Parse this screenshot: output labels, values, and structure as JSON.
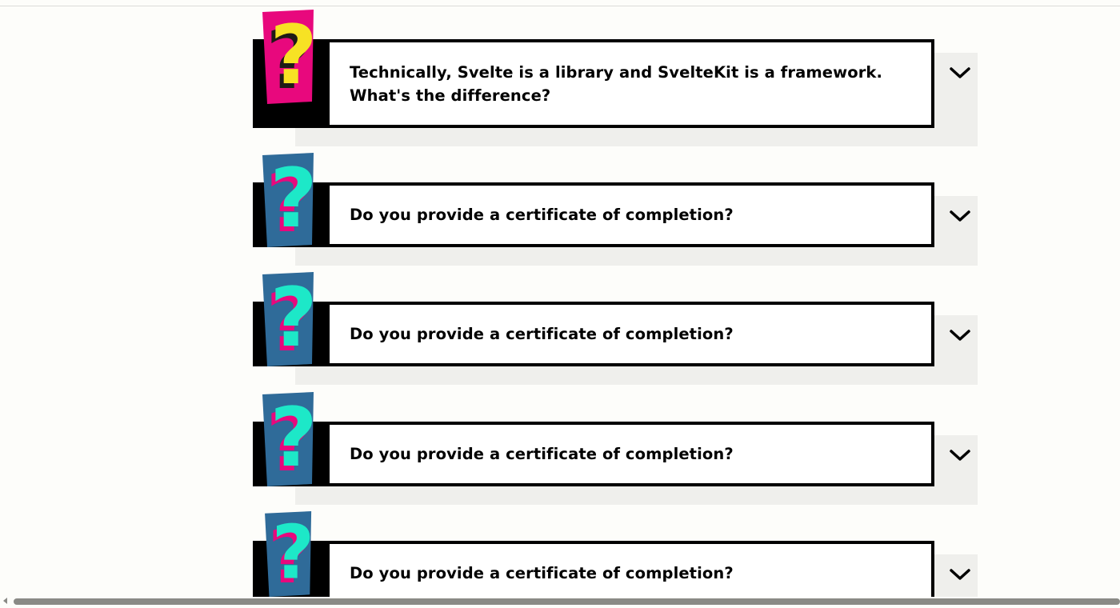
{
  "faq": {
    "items": [
      {
        "question_line1": "Technically, Svelte is a library and SvelteKit is a framework.",
        "question_line2": "What's the difference?",
        "badge_color": "#e8087d",
        "mark_color": "#f7e224",
        "shadow_color": "#1e1b16"
      },
      {
        "question_line1": "Do you provide a certificate of completion?",
        "question_line2": "",
        "badge_color": "#2f6b99",
        "mark_color": "#1de8c8",
        "shadow_color": "#e8087d"
      },
      {
        "question_line1": "Do you provide a certificate of completion?",
        "question_line2": "",
        "badge_color": "#2f6b99",
        "mark_color": "#1de8c8",
        "shadow_color": "#e8087d"
      },
      {
        "question_line1": "Do you provide a certificate of completion?",
        "question_line2": "",
        "badge_color": "#2f6b99",
        "mark_color": "#1de8c8",
        "shadow_color": "#e8087d"
      },
      {
        "question_line1": "Do you provide a certificate of completion?",
        "question_line2": "",
        "badge_color": "#2f6b99",
        "mark_color": "#1de8c8",
        "shadow_color": "#e8087d"
      }
    ],
    "expand_icon": "chevron-down-icon",
    "badge_icon": "question-mark-icon"
  },
  "colors": {
    "background": "#fdfdfa",
    "card_border": "#000000",
    "shadow_panel": "#efefec"
  }
}
